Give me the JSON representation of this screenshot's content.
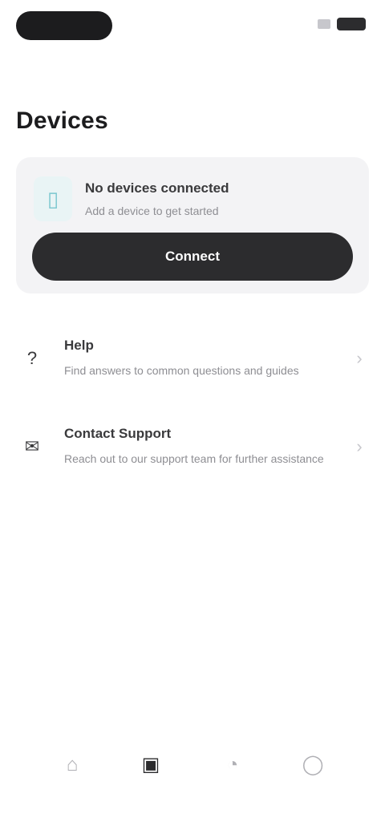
{
  "status_bar": {
    "time": "",
    "signal_icon": "signal-icon",
    "battery_icon": "battery-icon"
  },
  "header": {
    "title": "Devices"
  },
  "connect_card": {
    "icon": "device-icon",
    "title": "No devices connected",
    "subtitle": "Add a device to get started",
    "button_label": "Connect"
  },
  "list": {
    "items": [
      {
        "icon": "help-icon",
        "title": "Help",
        "description": "Find answers to common questions and guides"
      },
      {
        "icon": "support-icon",
        "title": "Contact Support",
        "description": "Reach out to our support team for further assistance"
      }
    ]
  },
  "bottom_nav": {
    "items": [
      {
        "icon": "home-icon",
        "label": ""
      },
      {
        "icon": "devices-icon",
        "label": ""
      },
      {
        "icon": "activity-icon",
        "label": ""
      },
      {
        "icon": "profile-icon",
        "label": ""
      }
    ],
    "active_index": 1
  },
  "colors": {
    "accent_dark": "#2c2c2e",
    "card_bg": "#f3f3f5",
    "device_icon": "#7cc7cf",
    "muted_text": "#8e8e93"
  }
}
